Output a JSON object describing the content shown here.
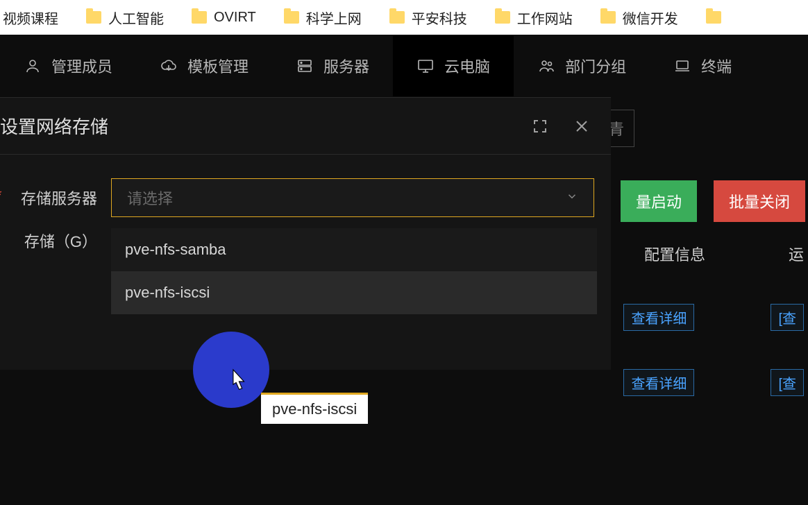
{
  "bookmarks": [
    {
      "label": "视频课程"
    },
    {
      "label": "人工智能"
    },
    {
      "label": "OVIRT"
    },
    {
      "label": "科学上网"
    },
    {
      "label": "平安科技"
    },
    {
      "label": "工作网站"
    },
    {
      "label": "微信开发"
    }
  ],
  "nav": {
    "items": [
      {
        "label": "管理成员",
        "icon": "user"
      },
      {
        "label": "模板管理",
        "icon": "cloud"
      },
      {
        "label": "服务器",
        "icon": "server"
      },
      {
        "label": "云电脑",
        "icon": "monitor",
        "active": true
      },
      {
        "label": "部门分组",
        "icon": "users"
      },
      {
        "label": "终端",
        "icon": "laptop"
      }
    ]
  },
  "behind": {
    "search_fragment": "青",
    "btn_start": "量启动",
    "btn_stop": "批量关闭",
    "col_config": "配置信息",
    "col_run": "运",
    "detail1": "查看详细",
    "detail2": "查看详细",
    "detail_edge": "[查"
  },
  "modal": {
    "title": "设置网络存储",
    "field_storage_server": "存储服务器",
    "field_storage_g": "存储（G）",
    "select_placeholder": "请选择",
    "options": [
      {
        "value": "pve-nfs-samba"
      },
      {
        "value": "pve-nfs-iscsi",
        "hovered": true
      }
    ],
    "tooltip_text": "pve-nfs-iscsi"
  }
}
